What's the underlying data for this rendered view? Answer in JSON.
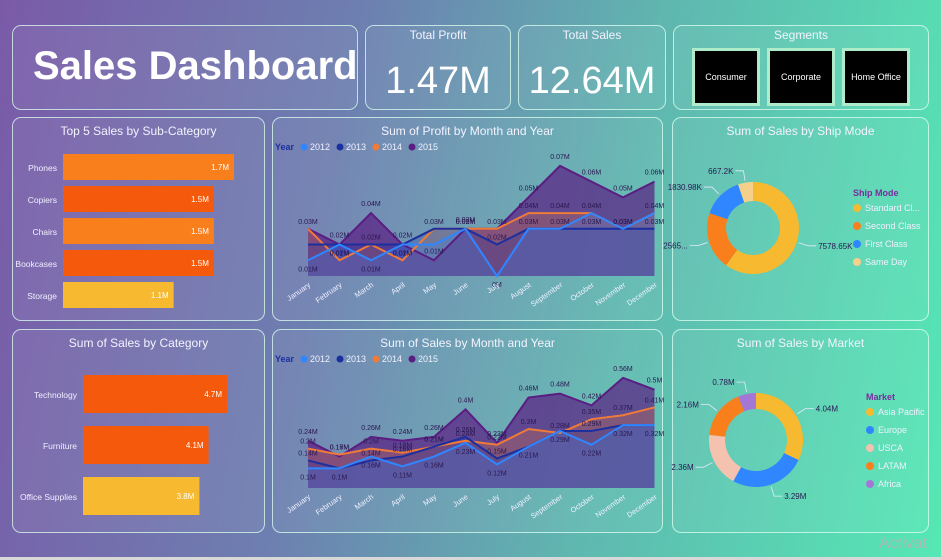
{
  "header": {
    "title": "Sales Dashboard"
  },
  "kpis": [
    {
      "label": "Total Profit",
      "value": "1.47M"
    },
    {
      "label": "Total Sales",
      "value": "12.64M"
    }
  ],
  "segments": {
    "title": "Segments",
    "options": [
      "Consumer",
      "Corporate",
      "Home Office"
    ]
  },
  "watermark": "Activat",
  "colors": {
    "y2012": "#2f86ff",
    "y2013": "#1c2f9e",
    "y2014": "#f07a38",
    "y2015": "#5a1d82",
    "orange": "#f97f1d",
    "dark_orange": "#f55a0c",
    "yellow": "#f7b92f"
  },
  "chart_data": [
    {
      "id": "subcat",
      "type": "bar",
      "title": "Top 5 Sales by Sub-Category",
      "categories": [
        "Phones",
        "Copiers",
        "Chairs",
        "Bookcases",
        "Storage"
      ],
      "values": [
        1.7,
        1.5,
        1.5,
        1.5,
        1.1
      ],
      "labels": [
        "1.7M",
        "1.5M",
        "1.5M",
        "1.5M",
        "1.1M"
      ],
      "colors": [
        "#f97f1d",
        "#f55a0c",
        "#f97f1d",
        "#f55a0c",
        "#f7b92f"
      ]
    },
    {
      "id": "category",
      "type": "bar",
      "title": "Sum of Sales by Category",
      "categories": [
        "Technology",
        "Furniture",
        "Office Supplies"
      ],
      "values": [
        4.7,
        4.1,
        3.8
      ],
      "labels": [
        "4.7M",
        "4.1M",
        "3.8M"
      ],
      "colors": [
        "#f55a0c",
        "#f55a0c",
        "#f7b92f"
      ]
    },
    {
      "id": "profit",
      "type": "area",
      "title": "Sum of Profit by Month and Year",
      "legend_title": "Year",
      "categories": [
        "January",
        "February",
        "March",
        "April",
        "May",
        "June",
        "July",
        "August",
        "September",
        "October",
        "November",
        "December"
      ],
      "ylim": [
        0,
        0.075
      ],
      "series": [
        {
          "name": "2012",
          "values": [
            0.01,
            0.02,
            0.01,
            0.02,
            0.02,
            0.03,
            0.0,
            0.03,
            0.03,
            0.04,
            0.03,
            0.04
          ],
          "labels": [
            "0.01M",
            "0.02M",
            "0.01M",
            "0.02M",
            "",
            "",
            "0M",
            "",
            "",
            "",
            "",
            ""
          ]
        },
        {
          "name": "2013",
          "values": [
            0.02,
            0.02,
            0.02,
            0.02,
            0.03,
            0.03,
            0.02,
            0.03,
            0.03,
            0.03,
            0.03,
            0.03
          ],
          "labels": [
            "",
            "",
            "",
            "",
            "",
            "0.02M",
            "0.02M",
            "0.03M",
            "0.03M",
            "0.03M",
            "0.03M",
            "0.03M"
          ]
        },
        {
          "name": "2014",
          "values": [
            0.03,
            0.01,
            0.02,
            0.01,
            0.03,
            0.03,
            0.03,
            0.04,
            0.04,
            0.04,
            0.03,
            0.04
          ],
          "labels": [
            "0.03M",
            "0.01M",
            "0.02M",
            "0.01M",
            "0.03M",
            "0.05M",
            "0.03M",
            "0.04M",
            "0.04M",
            "0.04M",
            "0.03M",
            "0.04M"
          ]
        },
        {
          "name": "2015",
          "values": [
            0.03,
            0.02,
            0.04,
            0.02,
            0.01,
            0.03,
            0.03,
            0.05,
            0.07,
            0.06,
            0.05,
            0.06
          ],
          "labels": [
            "",
            "0.02M",
            "0.04M",
            "0.02M",
            "0.01M",
            "0.03M",
            "",
            "0.05M",
            "0.07M",
            "0.06M",
            "0.05M",
            "0.06M"
          ]
        }
      ]
    },
    {
      "id": "sales",
      "type": "area",
      "title": "Sum of Sales by Month and Year",
      "legend_title": "Year",
      "categories": [
        "January",
        "February",
        "March",
        "April",
        "May",
        "June",
        "July",
        "August",
        "September",
        "October",
        "November",
        "December"
      ],
      "ylim": [
        0,
        0.6
      ],
      "series": [
        {
          "name": "2012",
          "values": [
            0.1,
            0.1,
            0.16,
            0.11,
            0.16,
            0.23,
            0.12,
            0.21,
            0.29,
            0.22,
            0.32,
            0.32
          ],
          "labels": [
            "0.1M",
            "0.1M",
            "0.16M",
            "0.11M",
            "0.16M",
            "0.23M",
            "0.12M",
            "0.21M",
            "0.29M",
            "0.22M",
            "0.32M",
            "0.32M"
          ]
        },
        {
          "name": "2013",
          "values": [
            0.14,
            0.1,
            0.14,
            0.16,
            0.21,
            0.26,
            0.15,
            0.21,
            0.29,
            0.29,
            0.32,
            0.32
          ],
          "labels": [
            "0.14M",
            "",
            "0.14M",
            "0.16M",
            "0.21M",
            "0.26M",
            "0.15M",
            "",
            "",
            "0.29M",
            "",
            ""
          ]
        },
        {
          "name": "2014",
          "values": [
            0.2,
            0.17,
            0.2,
            0.18,
            0.21,
            0.24,
            0.22,
            0.3,
            0.28,
            0.35,
            0.37,
            0.41
          ],
          "labels": [
            "0.2M",
            "0.17M",
            "0.2M",
            "0.18M",
            "0.21M",
            "0.24M",
            "0.22M",
            "0.3M",
            "0.28M",
            "0.35M",
            "0.37M",
            "0.41M"
          ]
        },
        {
          "name": "2015",
          "values": [
            0.24,
            0.16,
            0.26,
            0.24,
            0.26,
            0.4,
            0.23,
            0.46,
            0.48,
            0.42,
            0.56,
            0.5
          ],
          "labels": [
            "0.24M",
            "0.16M",
            "0.26M",
            "0.24M",
            "0.26M",
            "0.4M",
            "0.23M",
            "0.46M",
            "0.48M",
            "0.42M",
            "0.56M",
            "0.5M"
          ]
        }
      ]
    },
    {
      "id": "shipmode",
      "type": "pie",
      "title": "Sum of Sales by Ship Mode",
      "legend_title": "Ship Mode",
      "slices": [
        {
          "name": "Standard Cl...",
          "value": 7578.65,
          "label": "7578.65K",
          "color": "#f7b92f"
        },
        {
          "name": "Second Class",
          "value": 2565,
          "label": "2565...",
          "color": "#f97f1d"
        },
        {
          "name": "First Class",
          "value": 1830.98,
          "label": "1830.98K",
          "color": "#2f86ff"
        },
        {
          "name": "Same Day",
          "value": 667.2,
          "label": "667.2K",
          "color": "#f5d08a"
        }
      ]
    },
    {
      "id": "market",
      "type": "pie",
      "title": "Sum of Sales by Market",
      "legend_title": "Market",
      "slices": [
        {
          "name": "Asia Pacific",
          "value": 4.04,
          "label": "4.04M",
          "color": "#f7b92f"
        },
        {
          "name": "Europe",
          "value": 3.29,
          "label": "3.29M",
          "color": "#2f86ff"
        },
        {
          "name": "USCA",
          "value": 2.36,
          "label": "2.36M",
          "color": "#f5c2b0"
        },
        {
          "name": "LATAM",
          "value": 2.16,
          "label": "2.16M",
          "color": "#f97f1d"
        },
        {
          "name": "Africa",
          "value": 0.78,
          "label": "0.78M",
          "color": "#a477d6"
        }
      ]
    }
  ]
}
